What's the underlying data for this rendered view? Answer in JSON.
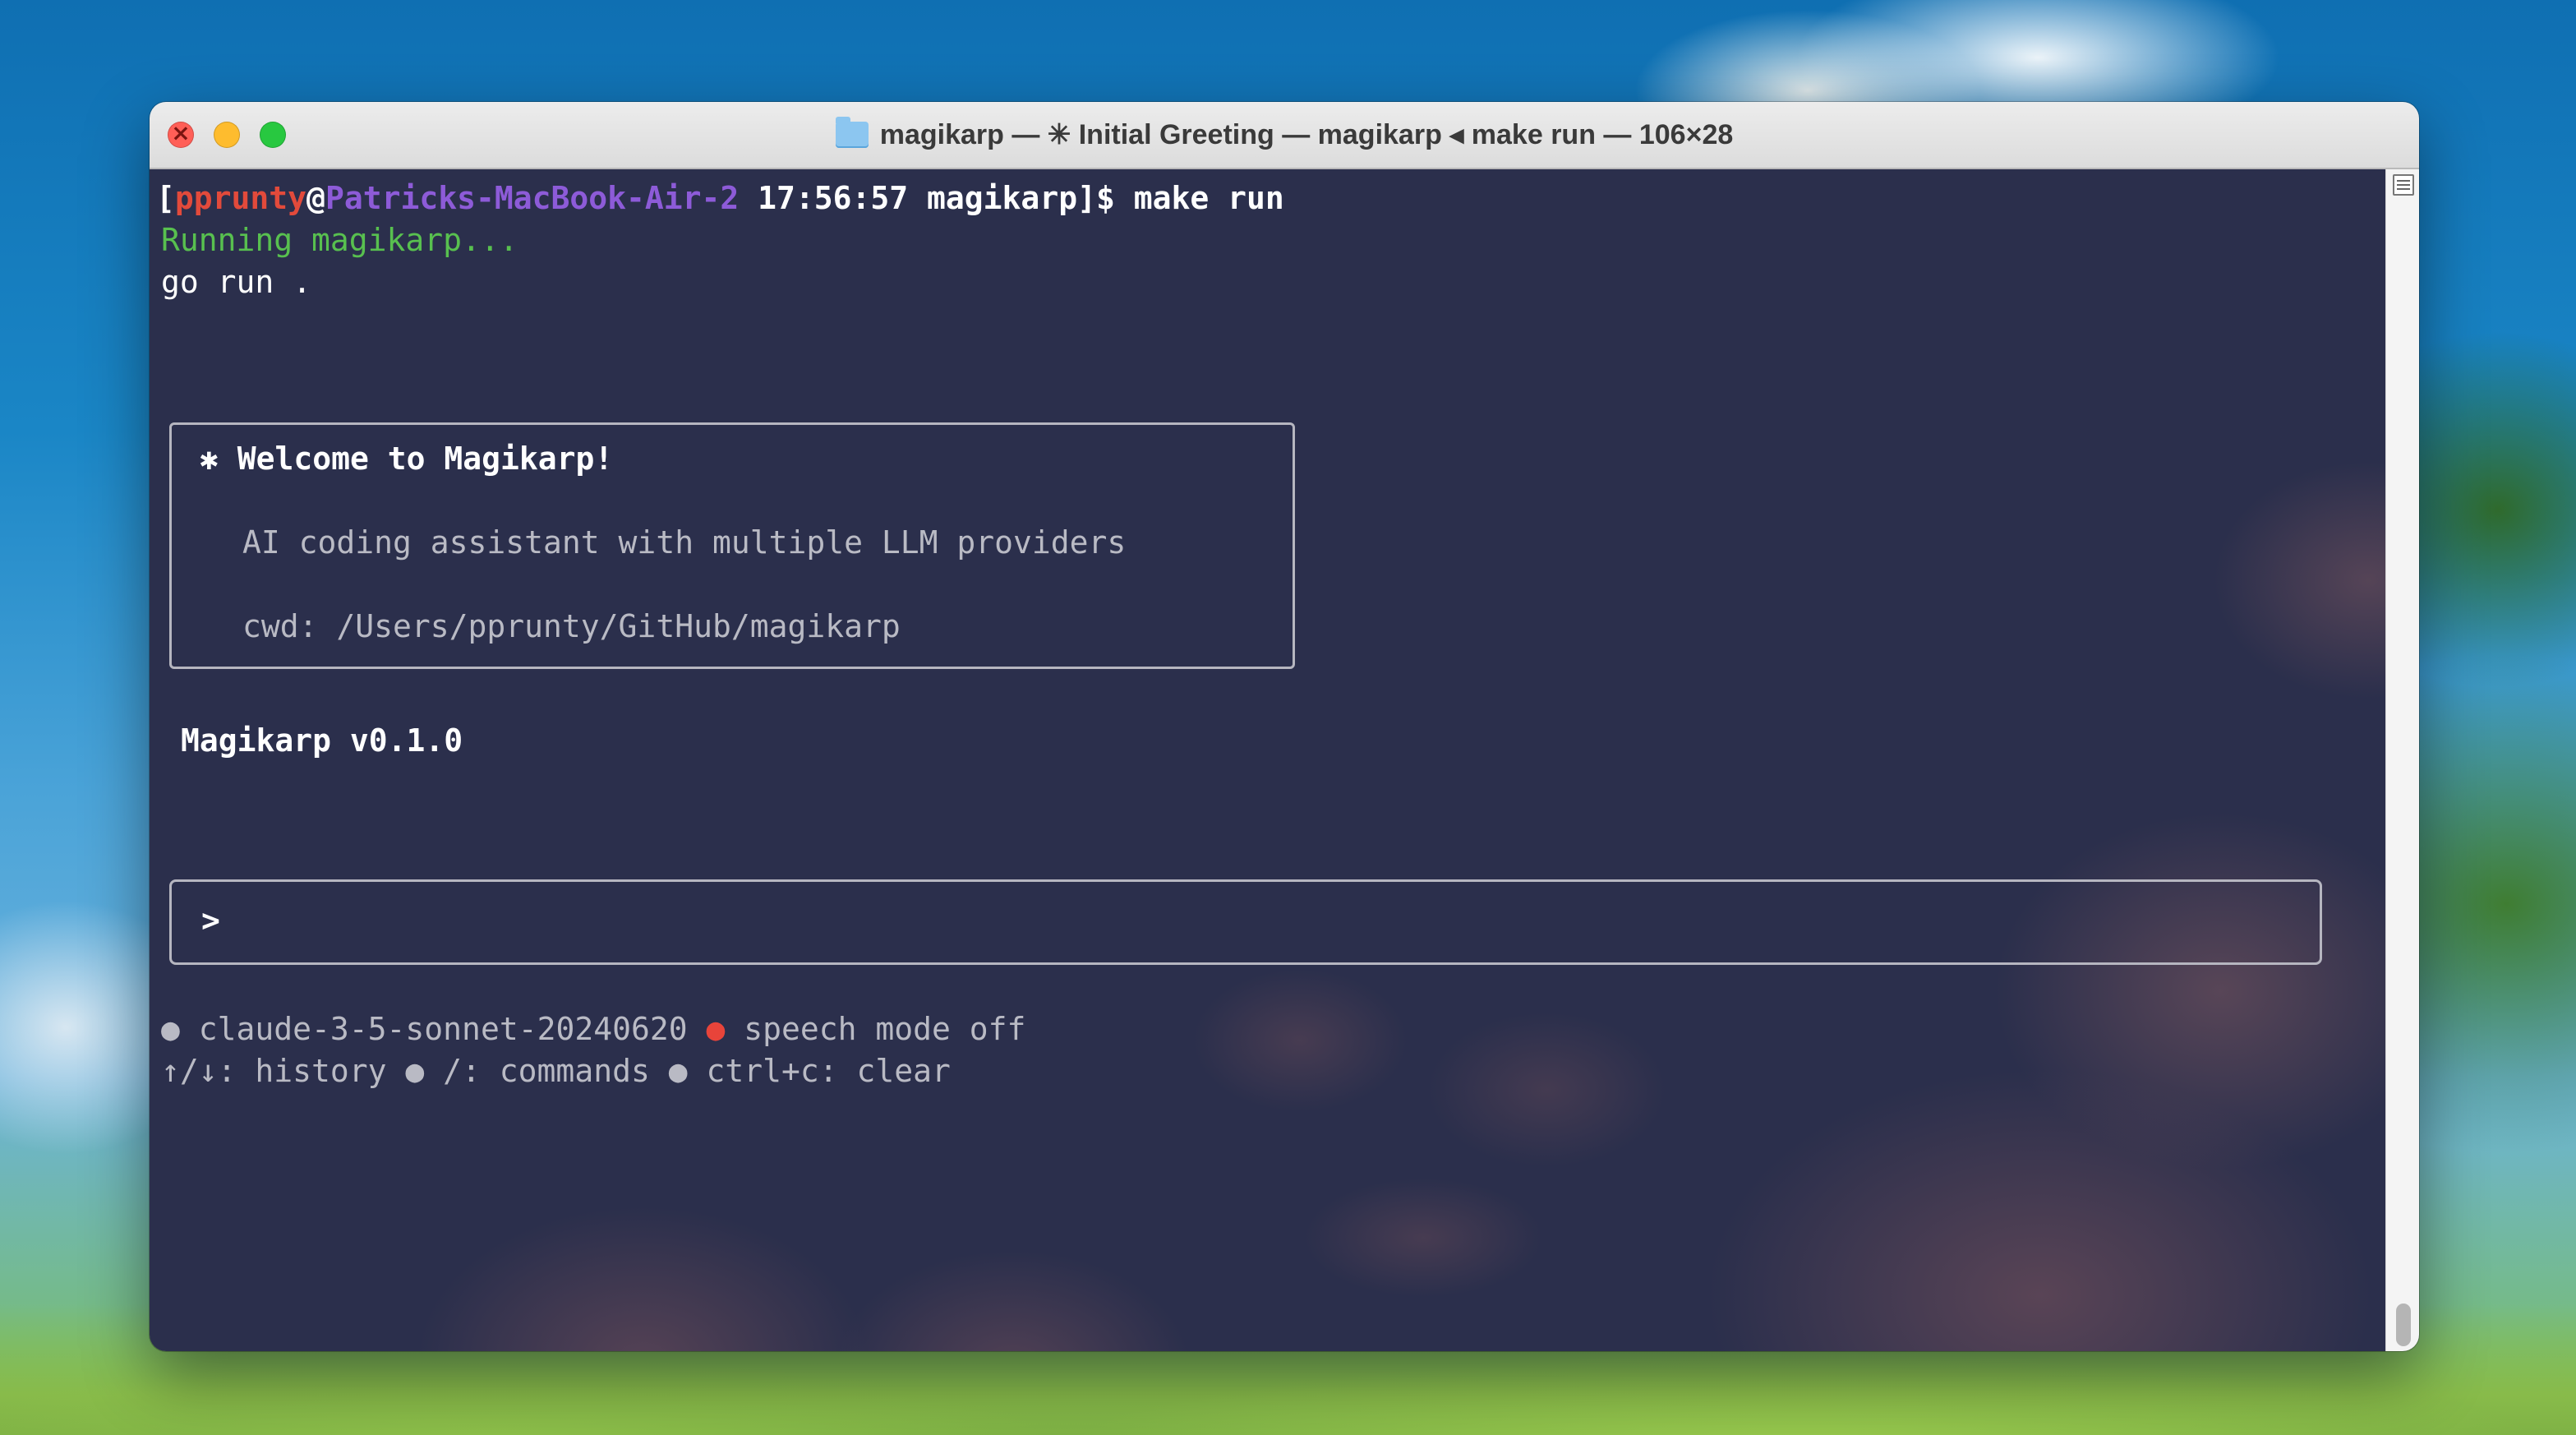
{
  "window": {
    "title": "magikarp — ✳ Initial Greeting — magikarp ◂ make run — 106×28"
  },
  "terminal": {
    "prompt_line": {
      "open_bracket": "[",
      "user": "pprunty",
      "at": "@",
      "host": "Patricks-MacBook-Air-2",
      "time_dir": " 17:56:57 magikarp]$ ",
      "command": "make run"
    },
    "running_line": "Running magikarp...",
    "go_run_line": "go run .",
    "welcome": {
      "heading": "✱ Welcome to Magikarp!",
      "description": "AI coding assistant with multiple LLM providers",
      "cwd": "cwd: /Users/pprunty/GitHub/magikarp"
    },
    "version": "Magikarp v0.1.0",
    "input": {
      "prompt_symbol": ">",
      "value": ""
    },
    "status": {
      "model_dot": "●",
      "model": " claude-3-5-sonnet-20240620 ",
      "speech_dot": "●",
      "speech": " speech mode off"
    },
    "help_line": "↑/↓: history ● /: commands ● ctrl+c: clear"
  },
  "colors": {
    "user": "#e24a3b",
    "host": "#8d5bd8",
    "success": "#58c04f",
    "speech_indicator": "#e8443a",
    "terminal_bg": "#2b2f4c"
  }
}
